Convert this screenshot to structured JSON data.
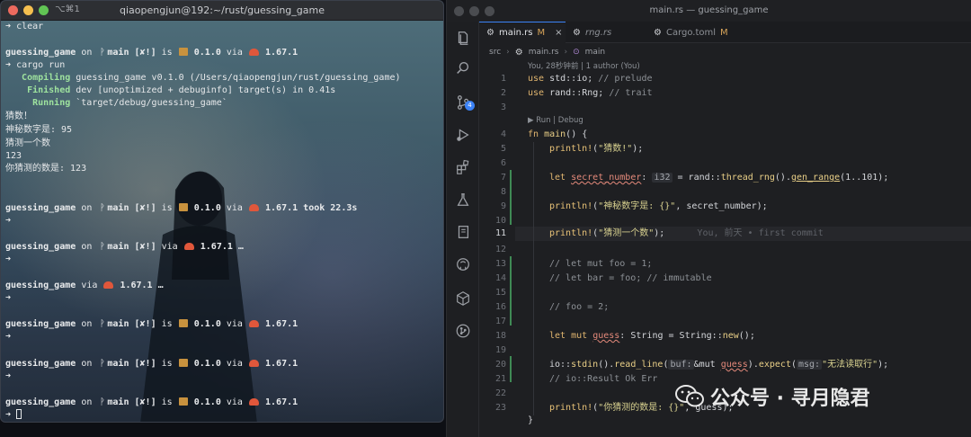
{
  "terminal": {
    "shortcut": "⌥⌘1",
    "title": "qiaopengjun@192:~/rust/guessing_game",
    "lines": [
      {
        "arrow": "➜",
        "cmd": "clear"
      },
      {
        "arrow": "",
        "cmd": ""
      },
      {
        "prompt": {
          "pkg": "guessing_game",
          "on": "on",
          "branch_icon": "ᚹ",
          "branch": "main",
          "status": "[✘!]",
          "is": "is",
          "version": "0.1.0",
          "via": "via",
          "rust": "1.67.1",
          "took": ""
        }
      },
      {
        "arrow": "➜",
        "cmd": "cargo run"
      },
      {
        "build": {
          "verb": "   Compiling",
          "rest": " guessing_game v0.1.0 (/Users/qiaopengjun/rust/guessing_game)"
        }
      },
      {
        "build": {
          "verb": "    Finished",
          "rest": " dev [unoptimized + debuginfo] target(s) in 0.41s"
        }
      },
      {
        "build": {
          "verb": "     Running",
          "rest": " `target/debug/guessing_game`"
        }
      },
      {
        "text": "猜数！"
      },
      {
        "text": "神秘数字是: 95"
      },
      {
        "text": "猜测一个数"
      },
      {
        "text": "123"
      },
      {
        "text": "你猜测的数是: 123"
      }
    ],
    "prompts": [
      {
        "pkg": "guessing_game",
        "on": "on",
        "branch_icon": "ᚹ",
        "branch": "main",
        "status": "[✘!]",
        "is": "is",
        "version": "0.1.0",
        "via": "via",
        "rust": "1.67.1",
        "took": "took 22.3s"
      },
      {
        "pkg": "guessing_game",
        "on": "on",
        "branch_icon": "ᚹ",
        "branch": "main",
        "status": "[✘!]",
        "is": "",
        "version": "",
        "via": "via",
        "rust": "1.67.1 …",
        "took": ""
      },
      {
        "pkg": "guessing_game",
        "on": "",
        "branch_icon": "",
        "branch": "",
        "status": "",
        "is": "",
        "version": "",
        "via": "via",
        "rust": "1.67.1 …",
        "took": ""
      },
      {
        "pkg": "guessing_game",
        "on": "on",
        "branch_icon": "ᚹ",
        "branch": "main",
        "status": "[✘!]",
        "is": "is",
        "version": "0.1.0",
        "via": "via",
        "rust": "1.67.1",
        "took": ""
      },
      {
        "pkg": "guessing_game",
        "on": "on",
        "branch_icon": "ᚹ",
        "branch": "main",
        "status": "[✘!]",
        "is": "is",
        "version": "0.1.0",
        "via": "via",
        "rust": "1.67.1",
        "took": ""
      },
      {
        "pkg": "guessing_game",
        "on": "on",
        "branch_icon": "ᚹ",
        "branch": "main",
        "status": "[✘!]",
        "is": "is",
        "version": "0.1.0",
        "via": "via",
        "rust": "1.67.1",
        "took": ""
      }
    ],
    "arrow": "➜"
  },
  "vscode": {
    "title": "main.rs — guessing_game",
    "tabs": [
      {
        "label": "main.rs",
        "mod": "M",
        "close": "×",
        "active": true
      },
      {
        "label": "rng.rs",
        "mod": "",
        "close": "",
        "active": false
      },
      {
        "label": "Cargo.toml",
        "mod": "M",
        "close": "",
        "active": false
      }
    ],
    "breadcrumb": [
      "src",
      "main.rs",
      "main"
    ],
    "blame_header": "You, 28秒钟前 | 1 author (You)",
    "run_lens": "▶ Run | Debug",
    "activity_badge": "4",
    "current_line": "11",
    "line_numbers": [
      "1",
      "2",
      "3",
      "4",
      "5",
      "6",
      "7",
      "8",
      "9",
      "10",
      "11",
      "12",
      "13",
      "14",
      "15",
      "16",
      "17",
      "18",
      "19",
      "20",
      "21",
      "22",
      "23",
      "24"
    ],
    "code": {
      "l1": {
        "kw": "use",
        "path": "std::io;",
        "com": "// prelude"
      },
      "l2": {
        "kw": "use",
        "path": "rand::Rng;",
        "com": "// trait"
      },
      "l4": {
        "kw": "fn",
        "name": "main",
        "rest": "() {"
      },
      "l5": {
        "mac": "println!",
        "open": "(",
        "str": "\"猜数!\"",
        "close": ");"
      },
      "l7": {
        "kw": "let",
        "var": "secret_number",
        "colon": ":",
        "hint": "i32",
        "eq": " = rand::",
        "fn1": "thread_rng",
        "mid": "().",
        "fn2": "gen_range",
        "args": "(1..101);"
      },
      "l9": {
        "mac": "println!",
        "open": "(",
        "str": "\"神秘数字是: {}\"",
        "rest": ", secret_number);"
      },
      "l11": {
        "mac": "println!",
        "open": "(",
        "str": "\"猜测一个数\"",
        "close": ");",
        "blame": "You, 前天 • first commit"
      },
      "l13": {
        "com": "// let mut foo = 1;"
      },
      "l14": {
        "com": "// let bar = foo; // immutable"
      },
      "l16": {
        "com": "// foo = 2;"
      },
      "l18": {
        "kw": "let mut",
        "var": "guess",
        "colon": ":",
        "ty": "String",
        "eq": " = String::",
        "fn1": "new",
        "rest": "();"
      },
      "l20": {
        "a": "io::",
        "fn1": "stdin",
        "b": "().",
        "fn2": "read_line",
        "c": "(",
        "hint1": "buf:",
        "d": "&mut ",
        "var": "guess",
        "e": ").",
        "fn3": "expect",
        "f": "(",
        "hint2": "msg:",
        "str": "\"无法读取行\"",
        "g": ");"
      },
      "l21": {
        "com": "// io::Result Ok Err"
      },
      "l23": {
        "mac": "println!",
        "open": "(",
        "str": "\"你猜测的数是: {}\"",
        "rest": ", guess);"
      },
      "l24": {
        "close": "}"
      }
    }
  },
  "watermark": {
    "text": "公众号 · 寻月隐君"
  },
  "colors": {
    "accent": "#3b82f6",
    "modified": "#d7a45a",
    "git_added": "#3f8a55"
  }
}
